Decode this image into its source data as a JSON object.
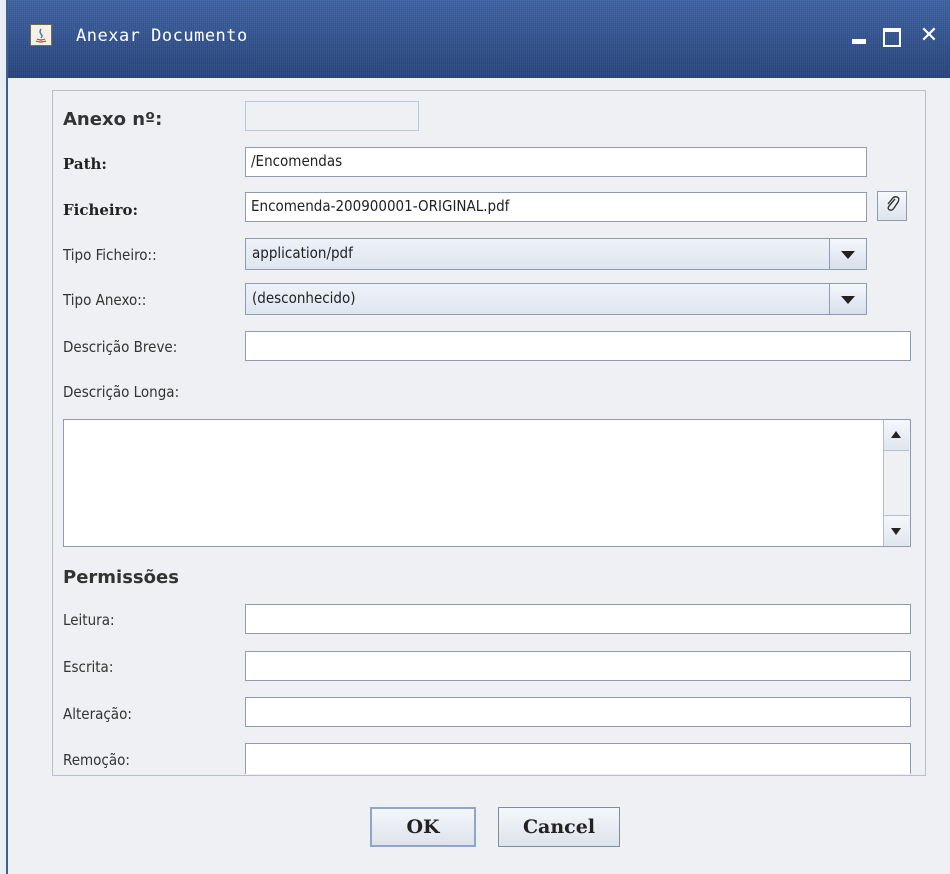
{
  "window": {
    "title": "Anexar Documento",
    "controls": {
      "minimize": "minimize",
      "maximize": "maximize",
      "close": "✕"
    }
  },
  "form": {
    "anexo_label": "Anexo nº:",
    "anexo_value": "",
    "path_label": "Path:",
    "path_value": "/Encomendas",
    "ficheiro_label": "Ficheiro:",
    "ficheiro_value": "Encomenda-200900001-ORIGINAL.pdf",
    "tipo_ficheiro_label": "Tipo Ficheiro::",
    "tipo_ficheiro_value": "application/pdf",
    "tipo_anexo_label": "Tipo Anexo::",
    "tipo_anexo_value": "(desconhecido)",
    "descricao_breve_label": "Descrição Breve:",
    "descricao_breve_value": "",
    "descricao_longa_label": "Descrição Longa:",
    "descricao_longa_value": ""
  },
  "permissoes": {
    "heading": "Permissões",
    "leitura_label": "Leitura:",
    "leitura_value": "",
    "escrita_label": "Escrita:",
    "escrita_value": "",
    "alteracao_label": "Alteração:",
    "alteracao_value": "",
    "remocao_label": "Remoção:",
    "remocao_value": ""
  },
  "buttons": {
    "ok": "OK",
    "cancel": "Cancel"
  },
  "icons": {
    "app": "java-icon",
    "attach": "paperclip-icon"
  },
  "colors": {
    "titlebar": "#2e4f8a",
    "panel": "#eef0f3",
    "field_border": "#8e9bb0"
  }
}
